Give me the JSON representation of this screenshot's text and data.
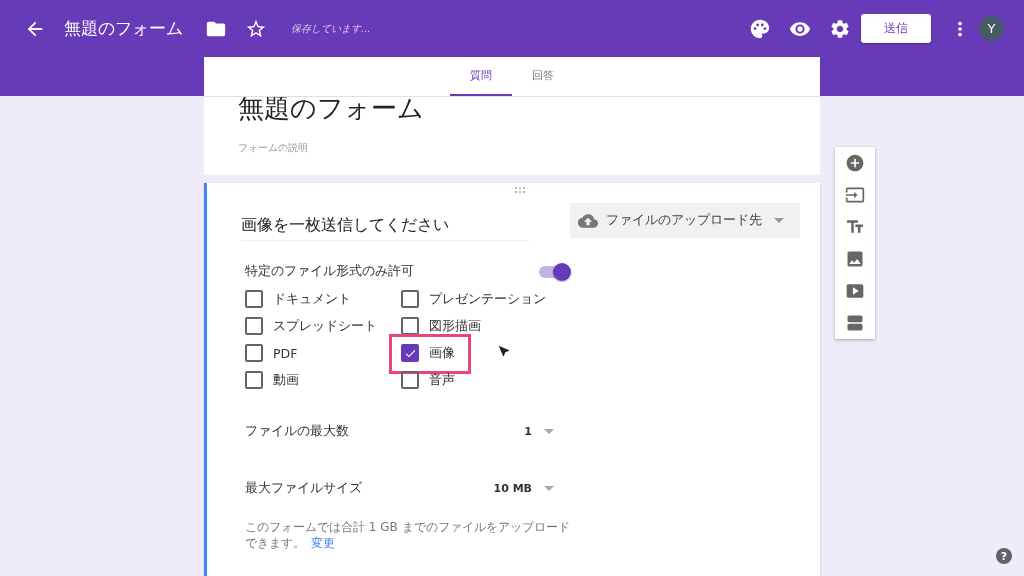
{
  "header": {
    "title": "無題のフォーム",
    "status": "保存しています...",
    "send_button": "送信",
    "avatar": "Y"
  },
  "tabs": [
    {
      "label": "質問",
      "selected": true
    },
    {
      "label": "回答",
      "selected": false
    }
  ],
  "form": {
    "title": "無題のフォーム",
    "description": "フォームの説明"
  },
  "question": {
    "title": "画像を一枚送信してください",
    "type_dropdown": "ファイルのアップロード先",
    "allow_specific_types": {
      "label": "特定のファイル形式のみ許可",
      "on": true
    },
    "file_types": [
      {
        "label": "ドキュメント",
        "checked": false,
        "highlighted": false
      },
      {
        "label": "プレゼンテーション",
        "checked": false,
        "highlighted": false
      },
      {
        "label": "スプレッドシート",
        "checked": false,
        "highlighted": false
      },
      {
        "label": "図形描画",
        "checked": false,
        "highlighted": false
      },
      {
        "label": "PDF",
        "checked": false,
        "highlighted": false
      },
      {
        "label": "画像",
        "checked": true,
        "highlighted": true
      },
      {
        "label": "動画",
        "checked": false,
        "highlighted": false
      },
      {
        "label": "音声",
        "checked": false,
        "highlighted": false
      }
    ],
    "settings": [
      {
        "label": "ファイルの最大数",
        "value": "1"
      },
      {
        "label": "最大ファイルサイズ",
        "value": "10 MB"
      }
    ],
    "note": {
      "text": "このフォームでは合計 1 GB までのファイルをアップロードできます。",
      "link": "変更"
    }
  },
  "help": "?"
}
